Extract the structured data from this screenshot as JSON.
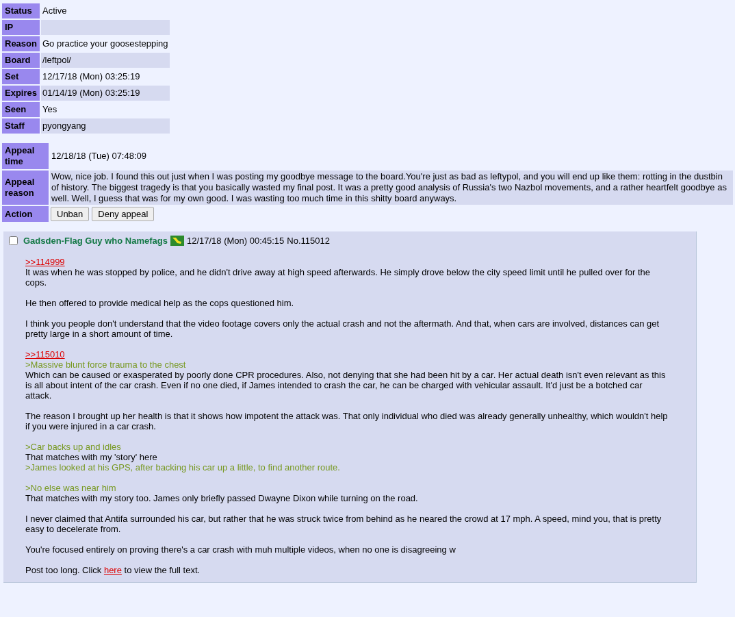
{
  "ban": [
    {
      "label": "Status",
      "value": "Active"
    },
    {
      "label": "IP"
    },
    {
      "label": "Reason",
      "value": "Go practice your goosestepping"
    },
    {
      "label": "Board",
      "value": "/leftpol/"
    },
    {
      "label": "Set",
      "value": "12/17/18 (Mon) 03:25:19"
    },
    {
      "label": "Expires",
      "value": "01/14/19 (Mon) 03:25:19"
    },
    {
      "label": "Seen",
      "value": "Yes"
    },
    {
      "label": "Staff",
      "value": "pyongyang"
    }
  ],
  "appeal": {
    "time_label": "Appeal time",
    "time": "12/18/18 (Tue) 07:48:09",
    "reason_label": "Appeal reason",
    "reason": "Wow, nice job. I found this out just when I was posting my goodbye message to the board.You're just as bad as leftypol, and you will end up like them: rotting in the dustbin of history. The biggest tragedy is that you basically wasted my final post. It was a pretty good analysis of Russia's two Nazbol movements, and a rather heartfelt goodbye as well. Well, I guess that was for my own good. I was wasting too much time in this shitty board anyways.",
    "action_label": "Action",
    "buttons": [
      "Unban",
      "Deny appeal"
    ]
  },
  "post": {
    "checked": false,
    "name": "Gadsden-Flag Guy who Namefags",
    "date": "12/17/18 (Mon) 00:45:15",
    "number": "No.115012",
    "paragraphs": [
      [
        {
          "kind": "reply",
          "text": ">>114999"
        },
        {
          "kind": "text",
          "text": "It was when he was stopped by police, and he didn't drive away at high speed afterwards. He simply drove below the city speed limit until he pulled over for the cops."
        }
      ],
      [
        {
          "kind": "text",
          "text": "He then offered to provide medical help as the cops questioned him."
        }
      ],
      [
        {
          "kind": "text",
          "text": "I think you people don't understand that the video footage covers only the actual crash and not the aftermath. And that, when cars are involved, distances can get pretty large in a short amount of time."
        }
      ],
      [
        {
          "kind": "reply",
          "text": ">>115010"
        },
        {
          "kind": "quote",
          "text": ">Massive blunt force trauma to the chest"
        },
        {
          "kind": "text",
          "text": "Which can be caused or exasperated by poorly done CPR procedures. Also, not denying that she had been hit by a car. Her actual death isn't even relevant as this is all about intent of the car crash. Even if no one died, if James intended to crash the car, he can be charged with vehicular assault. It'd just be a botched car attack."
        }
      ],
      [
        {
          "kind": "text",
          "text": "The reason I brought up her health is that it shows how impotent the attack was. That only individual who died was already generally unhealthy, which wouldn't help if you were injured in a car crash."
        }
      ],
      [
        {
          "kind": "quote",
          "text": ">Car backs up and idles"
        },
        {
          "kind": "text",
          "text": "That matches with my 'story' here"
        },
        {
          "kind": "quote",
          "text": ">James looked at his GPS, after backing his car up a little, to find another route."
        }
      ],
      [
        {
          "kind": "quote",
          "text": ">No else was near him"
        },
        {
          "kind": "text",
          "text": "That matches with my story too. James only briefly passed Dwayne Dixon while turning on the road."
        }
      ],
      [
        {
          "kind": "text",
          "text": "I never claimed that Antifa surrounded his car, but rather that he was struck twice from behind as he neared the crowd at 17 mph. A speed, mind you, that is pretty easy to decelerate from."
        }
      ],
      [
        {
          "kind": "text",
          "text": "You're focused entirely on proving there's a car crash with muh multiple videos, when no one is disagreeing w"
        }
      ]
    ],
    "notice": {
      "before": "Post too long. Click",
      "link": "here",
      "after": "to view the full text."
    }
  }
}
